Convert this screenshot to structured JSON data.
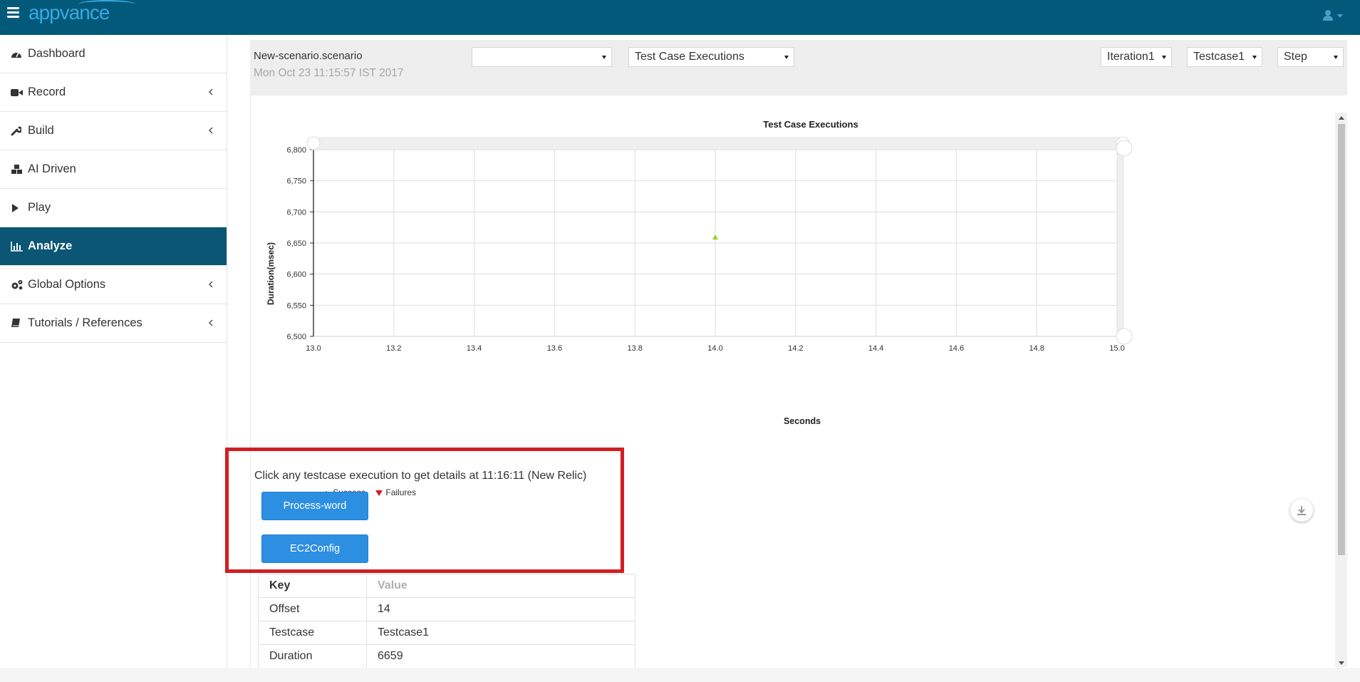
{
  "app": {
    "brand": "appvance"
  },
  "sidebar": {
    "items": [
      {
        "label": "Dashboard",
        "icon": "dashboard-icon",
        "has_submenu": false,
        "active": false
      },
      {
        "label": "Record",
        "icon": "video-camera-icon",
        "has_submenu": true,
        "active": false
      },
      {
        "label": "Build",
        "icon": "wrench-icon",
        "has_submenu": true,
        "active": false
      },
      {
        "label": "AI Driven",
        "icon": "cubes-icon",
        "has_submenu": false,
        "active": false
      },
      {
        "label": "Play",
        "icon": "play-icon",
        "has_submenu": false,
        "active": false
      },
      {
        "label": "Analyze",
        "icon": "bar-chart-icon",
        "has_submenu": false,
        "active": true
      },
      {
        "label": "Global Options",
        "icon": "gears-icon",
        "has_submenu": true,
        "active": false
      },
      {
        "label": "Tutorials / References",
        "icon": "book-icon",
        "has_submenu": true,
        "active": false
      }
    ]
  },
  "toolbar": {
    "scenario_name": "New-scenario.scenario",
    "scenario_date": "Mon Oct 23 11:15:57 IST 2017",
    "select_empty": "",
    "select_report": "Test Case Executions",
    "select_iteration": "Iteration1",
    "select_testcase": "Testcase1",
    "select_step": "Step"
  },
  "chart_data": {
    "type": "scatter",
    "title": "Test Case Executions",
    "xlabel": "Seconds",
    "ylabel": "Duration(msec)",
    "xlim": [
      13.0,
      15.0
    ],
    "ylim": [
      6500,
      6800
    ],
    "x_ticks": [
      "13.0",
      "13.2",
      "13.4",
      "13.6",
      "13.8",
      "14.0",
      "14.2",
      "14.4",
      "14.6",
      "14.8",
      "15.0"
    ],
    "y_ticks": [
      "6,800",
      "6,750",
      "6,700",
      "6,650",
      "6,600",
      "6,550",
      "6,500"
    ],
    "grid": true,
    "series": [
      {
        "name": "Success",
        "color": "#9acd32",
        "marker": "triangle",
        "points": [
          {
            "x": 14.0,
            "y": 6659
          }
        ]
      },
      {
        "name": "Failures",
        "color": "#d01f23",
        "marker": "triangle-down",
        "points": []
      }
    ],
    "legend": [
      "Success",
      "Failures"
    ]
  },
  "details": {
    "prompt": "Click any testcase execution to get details at 11:16:11 (New Relic)",
    "buttons": [
      "Process-word",
      "EC2Config"
    ]
  },
  "table": {
    "headers": [
      "Key",
      "Value"
    ],
    "rows": [
      [
        "Offset",
        "14"
      ],
      [
        "Testcase",
        "Testcase1"
      ],
      [
        "Duration",
        "6659"
      ]
    ]
  }
}
